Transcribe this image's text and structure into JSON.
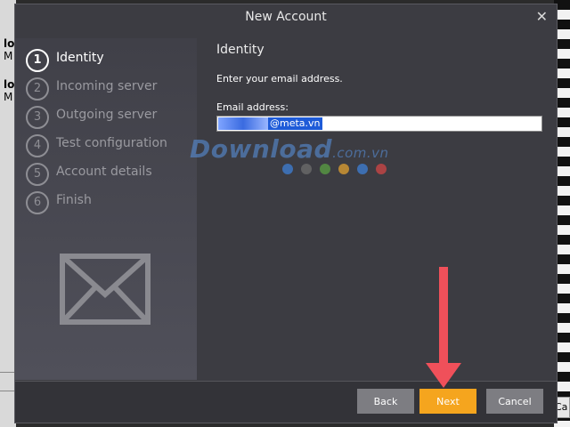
{
  "background": {
    "left_fragments": [
      "lo",
      "M",
      "lo",
      "M"
    ],
    "right_stub": "Ca"
  },
  "dialog": {
    "title": "New Account",
    "close_glyph": "✕",
    "steps": [
      {
        "num": "1",
        "label": "Identity",
        "active": true
      },
      {
        "num": "2",
        "label": "Incoming server",
        "active": false
      },
      {
        "num": "3",
        "label": "Outgoing server",
        "active": false
      },
      {
        "num": "4",
        "label": "Test configuration",
        "active": false
      },
      {
        "num": "5",
        "label": "Account details",
        "active": false
      },
      {
        "num": "6",
        "label": "Finish",
        "active": false
      }
    ],
    "content": {
      "heading": "Identity",
      "instruction": "Enter your email address.",
      "email_label": "Email address:",
      "email_value": "@meta.vn"
    },
    "buttons": {
      "back": "Back",
      "next": "Next",
      "cancel": "Cancel"
    }
  },
  "watermark": {
    "brand": "Download",
    "suffix": ".com.vn"
  },
  "colors": {
    "accent_next": "#f5a51e",
    "annotation_arrow": "#f0505a",
    "selection": "#1e5bd8"
  },
  "icons": {
    "envelope": "envelope-icon",
    "close": "close-icon",
    "arrow": "down-arrow-annotation"
  }
}
